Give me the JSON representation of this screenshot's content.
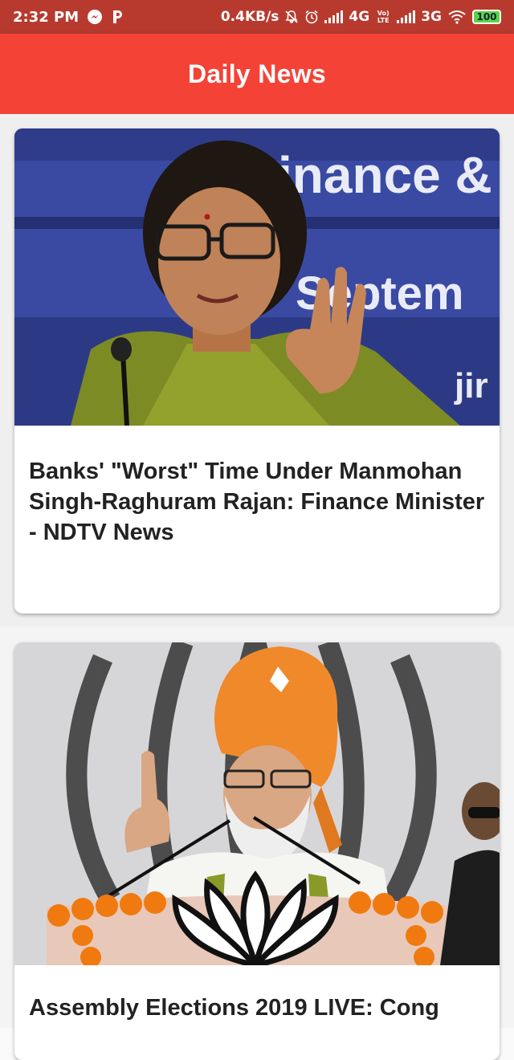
{
  "status_bar": {
    "time": "2:32 PM",
    "speed": "0.4KB/s",
    "net1": "4G",
    "volte": "Vo) LTE",
    "net2": "3G",
    "battery": "100",
    "icons": [
      "messenger-icon",
      "parking-app-icon",
      "mute-icon",
      "alarm-icon",
      "signal-icon",
      "wifi-icon",
      "battery-icon"
    ]
  },
  "app_bar": {
    "title": "Daily News",
    "color": "#f44336"
  },
  "articles": [
    {
      "image_text": [
        "inance &",
        "Septem",
        "jir"
      ],
      "title": "Banks' \"Worst\" Time Under Manmohan Singh-Raghuram Rajan: Finance Minister - NDTV News"
    },
    {
      "image_text": [],
      "title": "Assembly Elections 2019 LIVE: Cong"
    }
  ]
}
